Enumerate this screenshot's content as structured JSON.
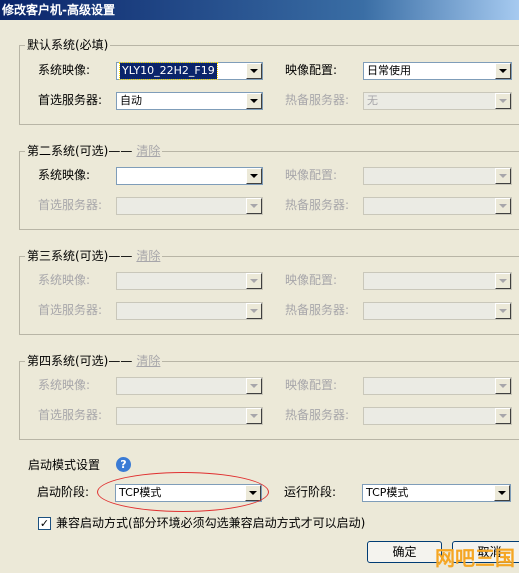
{
  "window": {
    "title": "修改客户机-高级设置"
  },
  "group1": {
    "legend": "默认系统(必填)",
    "clear": "",
    "image_label": "系统映像:",
    "image_value": "YLY10_22H2_F19",
    "config_label": "映像配置:",
    "config_value": "日常使用",
    "preferred_label": "首选服务器:",
    "preferred_value": "自动",
    "standby_label": "热备服务器:",
    "standby_value": "无"
  },
  "group2": {
    "legend": "第二系统(可选)",
    "clear": "清除",
    "image_label": "系统映像:",
    "image_value": "",
    "config_label": "映像配置:",
    "config_value": "",
    "preferred_label": "首选服务器:",
    "preferred_value": "",
    "standby_label": "热备服务器:",
    "standby_value": ""
  },
  "group3": {
    "legend": "第三系统(可选)",
    "clear": "清除",
    "image_label": "系统映像:",
    "image_value": "",
    "config_label": "映像配置:",
    "config_value": "",
    "preferred_label": "首选服务器:",
    "preferred_value": "",
    "standby_label": "热备服务器:",
    "standby_value": ""
  },
  "group4": {
    "legend": "第四系统(可选)",
    "clear": "清除",
    "image_label": "系统映像:",
    "image_value": "",
    "config_label": "映像配置:",
    "config_value": "",
    "preferred_label": "首选服务器:",
    "preferred_value": "",
    "standby_label": "热备服务器:",
    "standby_value": ""
  },
  "boot": {
    "title": "启动模式设置",
    "help": "?",
    "boot_stage_label": "启动阶段:",
    "boot_stage_value": "TCP模式",
    "run_stage_label": "运行阶段:",
    "run_stage_value": "TCP模式"
  },
  "compat": {
    "checked": true,
    "mark": "✓",
    "label": "兼容启动方式(部分环境必须勾选兼容启动方式才可以启动)"
  },
  "buttons": {
    "ok": "确定",
    "cancel": "取消"
  },
  "watermark": "网吧三国",
  "colors": {
    "title_bar": "#0a246a",
    "highlight": "#0a246a",
    "annotation": "#e03030",
    "watermark": "#f5a623"
  }
}
